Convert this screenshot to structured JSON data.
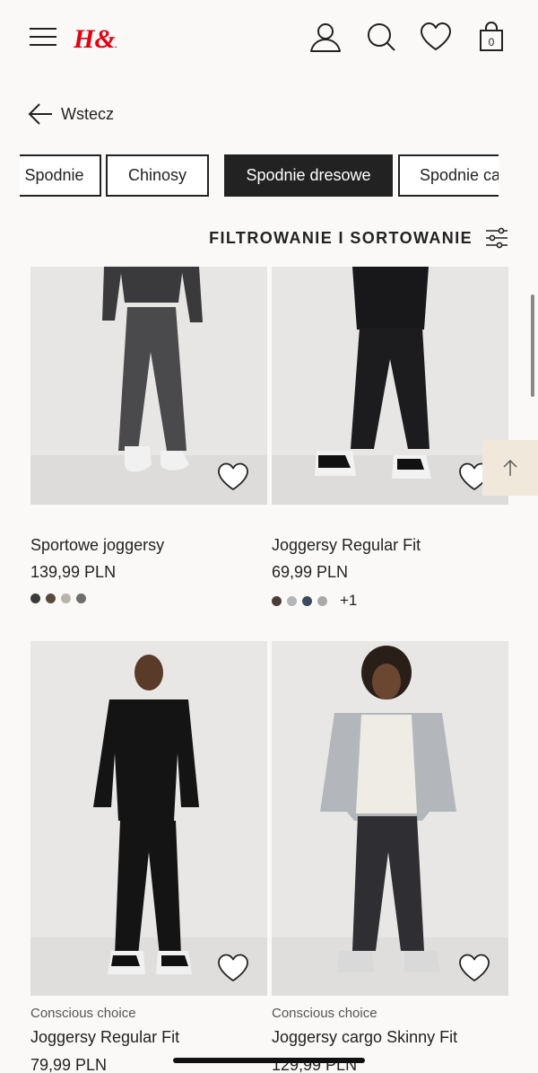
{
  "header": {
    "logo": "H&M",
    "icons": [
      "menu-icon",
      "account-icon",
      "search-icon",
      "wishlist-icon",
      "bag-icon"
    ],
    "bag_count": "0",
    "brand_color": "#e50010"
  },
  "back": {
    "label": "Wstecz"
  },
  "categories": [
    {
      "label": "Spodnie",
      "active": false
    },
    {
      "label": "Chinosy",
      "active": false
    },
    {
      "label": "Spodnie dresowe",
      "active": true
    },
    {
      "label": "Spodnie cargo",
      "active": false
    }
  ],
  "filter": {
    "label": "FILTROWANIE I SORTOWANIE"
  },
  "products": [
    {
      "title": "Sportowe joggersy",
      "price": "139,99 PLN",
      "swatches": [
        "#3a3a3a",
        "#5a4a3e",
        "#b8b4aa",
        "#6f6f6a"
      ],
      "more": ""
    },
    {
      "title": "Joggersy Regular Fit",
      "price": "69,99 PLN",
      "swatches": [
        "#4a3d36",
        "#b6b6b6",
        "#3d4a5c",
        "#a9a9a9"
      ],
      "more": "+1"
    },
    {
      "label": "Conscious choice",
      "title": "Joggersy Regular Fit",
      "price": "79,99 PLN"
    },
    {
      "label": "Conscious choice",
      "title": "Joggersy cargo Skinny Fit",
      "price": "129,99 PLN"
    }
  ]
}
